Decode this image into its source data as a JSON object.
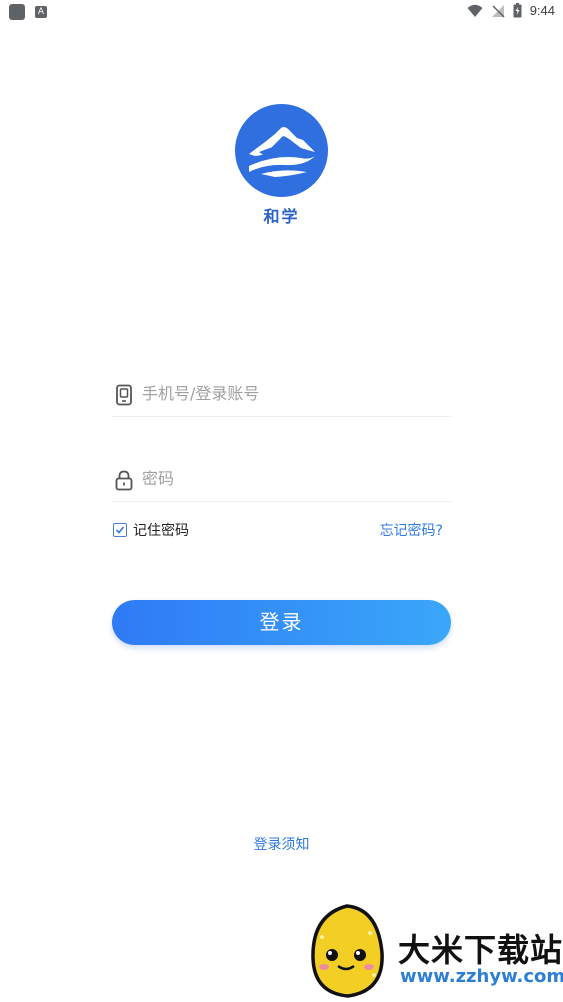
{
  "status_bar": {
    "time": "9:44",
    "notif_letter": "A"
  },
  "app": {
    "name": "和学"
  },
  "form": {
    "account_placeholder": "手机号/登录账号",
    "password_placeholder": "密码",
    "remember_label": "记住密码",
    "remember_checked": true,
    "forgot_label": "忘记密码?",
    "login_label": "登录"
  },
  "footer": {
    "notice_label": "登录须知"
  },
  "watermark": {
    "title": "大米下载站",
    "url": "www.zzhyw.com"
  },
  "colors": {
    "primary": "#2f7ae0",
    "logo_blue": "#2b62c8",
    "button_start": "#2f7af6",
    "button_end": "#3aa7f9"
  }
}
